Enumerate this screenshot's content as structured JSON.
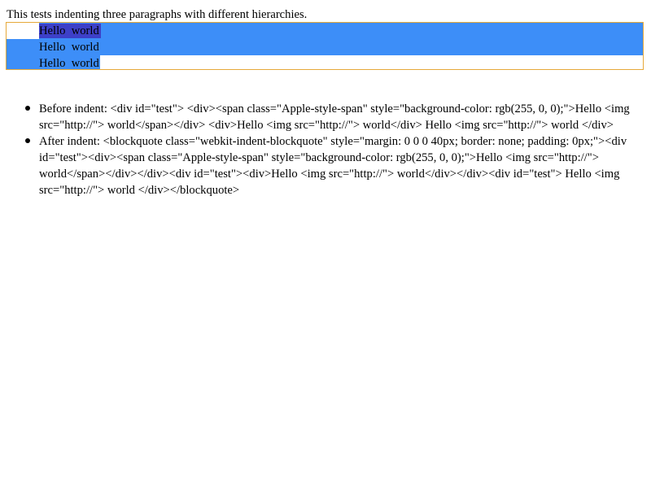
{
  "intro_text": "This tests indenting three paragraphs with different hierarchies.",
  "editor": {
    "lines": [
      "Hello  world",
      "Hello  world",
      "Hello  world"
    ],
    "selection_color": "#3d8ef8",
    "span_highlight_color": "#3d40c8",
    "focus_border_color": "#e6a93a"
  },
  "results": [
    {
      "label": "Before indent:",
      "text": "Before indent: <div id=\"test\"> <div><span class=\"Apple-style-span\" style=\"background-color: rgb(255, 0, 0);\">Hello <img src=\"http://\"> world</span></div> <div>Hello <img src=\"http://\"> world</div> Hello <img src=\"http://\"> world </div>"
    },
    {
      "label": "After indent:",
      "text": "After indent: <blockquote class=\"webkit-indent-blockquote\" style=\"margin: 0 0 0 40px; border: none; padding: 0px;\"><div id=\"test\"><div><span class=\"Apple-style-span\" style=\"background-color: rgb(255, 0, 0);\">Hello <img src=\"http://\"> world</span></div></div><div id=\"test\"><div>Hello <img src=\"http://\"> world</div></div><div id=\"test\"> Hello <img src=\"http://\"> world </div></blockquote>"
    }
  ]
}
